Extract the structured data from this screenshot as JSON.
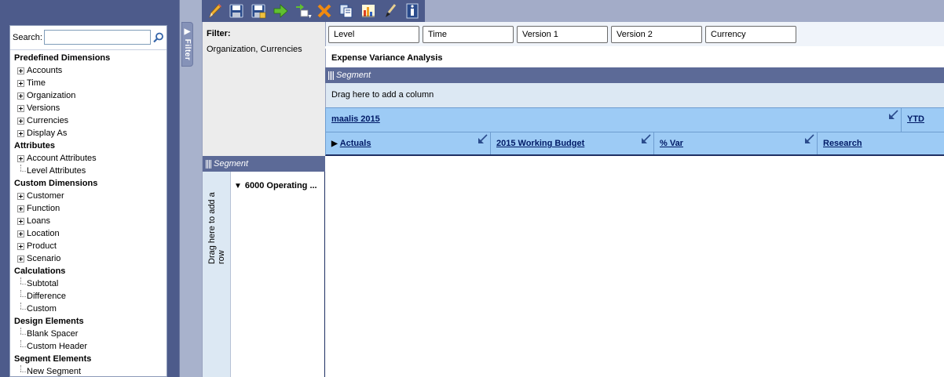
{
  "toolbar": {
    "buttons": [
      {
        "name": "edit-button",
        "icon": "pencil-icon"
      },
      {
        "name": "save-button",
        "icon": "floppy-icon"
      },
      {
        "name": "save-as-button",
        "icon": "floppy-as-icon"
      },
      {
        "name": "run-button",
        "icon": "green-arrow-icon"
      },
      {
        "name": "insert-button",
        "icon": "insert-icon"
      },
      {
        "name": "delete-button",
        "icon": "x-icon"
      },
      {
        "name": "copy-button",
        "icon": "copy-icon"
      },
      {
        "name": "chart-button",
        "icon": "chart-icon"
      },
      {
        "name": "format-button",
        "icon": "brush-icon"
      },
      {
        "name": "info-button",
        "icon": "info-icon"
      }
    ]
  },
  "sidebar": {
    "search_label": "Search:",
    "search_value": "",
    "groups": [
      {
        "heading": "Predefined Dimensions",
        "items": [
          {
            "label": "Accounts",
            "expandable": true
          },
          {
            "label": "Time",
            "expandable": true
          },
          {
            "label": "Organization",
            "expandable": true
          },
          {
            "label": "Versions",
            "expandable": true
          },
          {
            "label": "Currencies",
            "expandable": true
          },
          {
            "label": "Display As",
            "expandable": true
          }
        ]
      },
      {
        "heading": "Attributes",
        "items": [
          {
            "label": "Account Attributes",
            "expandable": true
          },
          {
            "label": "Level Attributes",
            "expandable": false
          }
        ]
      },
      {
        "heading": "Custom Dimensions",
        "items": [
          {
            "label": "Customer",
            "expandable": true
          },
          {
            "label": "Function",
            "expandable": true
          },
          {
            "label": "Loans",
            "expandable": true
          },
          {
            "label": "Location",
            "expandable": true
          },
          {
            "label": "Product",
            "expandable": true
          },
          {
            "label": "Scenario",
            "expandable": true
          }
        ]
      },
      {
        "heading": "Calculations",
        "items": [
          {
            "label": "Subtotal",
            "expandable": false
          },
          {
            "label": "Difference",
            "expandable": false
          },
          {
            "label": "Custom",
            "expandable": false
          }
        ]
      },
      {
        "heading": "Design Elements",
        "items": [
          {
            "label": "Blank Spacer",
            "expandable": false
          },
          {
            "label": "Custom Header",
            "expandable": false
          }
        ]
      },
      {
        "heading": "Segment Elements",
        "items": [
          {
            "label": "New Segment",
            "expandable": false
          }
        ]
      }
    ]
  },
  "filter_tab": {
    "label": "Filter"
  },
  "filter_panel": {
    "title": "Filter:",
    "text": "Organization, Currencies"
  },
  "dimension_bar": {
    "items": [
      "Level",
      "Time",
      "Version 1",
      "Version 2",
      "Currency"
    ]
  },
  "report": {
    "title": "Expense Variance Analysis",
    "column_segment_label": "Segment",
    "column_drag_hint": "Drag here to add a column",
    "row_segment_label": "Segment",
    "row_drag_hint": "Drag here to add a row",
    "row_items": [
      {
        "label": "6000 Operating ..."
      }
    ],
    "column_header_row1": [
      {
        "label": "maalis 2015"
      },
      {
        "label": "YTD"
      }
    ],
    "column_header_row2": [
      {
        "label": "Actuals",
        "collapsible": true
      },
      {
        "label": "2015 Working Budget"
      },
      {
        "label": "% Var"
      },
      {
        "label": "Research"
      }
    ]
  },
  "colors": {
    "navy": "#4d5b8b",
    "segment_header": "#5c6a97",
    "column_header": "#9dcbf5",
    "drag_zone": "#dce8f3"
  }
}
